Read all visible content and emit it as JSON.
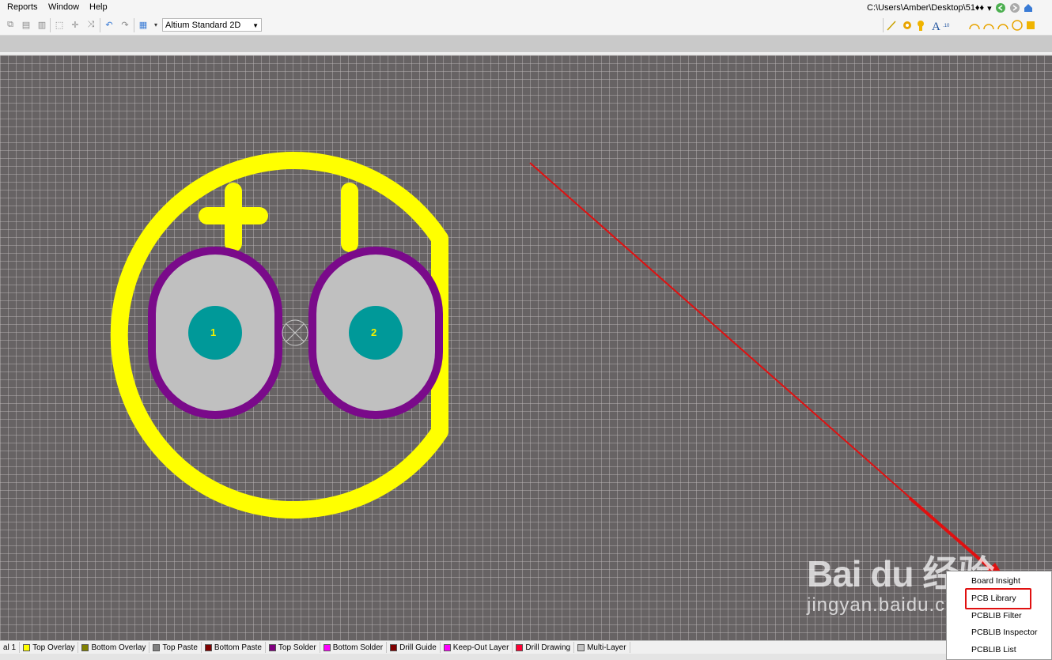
{
  "menu": {
    "reports": "Reports",
    "window": "Window",
    "help": "Help"
  },
  "path": {
    "text": "C:\\Users\\Amber\\Desktop\\51♦♦",
    "dropdown": "▾"
  },
  "toolbar": {
    "view_mode": "Altium Standard 2D",
    "dropdown_arrow": "▼"
  },
  "pcb": {
    "pads": [
      {
        "label": "1"
      },
      {
        "label": "2"
      }
    ],
    "colors": {
      "overlay": "#ffff00",
      "solder": "#7a0a8a",
      "pad": "#c0c0c0",
      "hole": "#009999",
      "background": "#676364"
    }
  },
  "layers": [
    {
      "name": "al 1",
      "color": ""
    },
    {
      "name": "Top Overlay",
      "color": "#ffff00"
    },
    {
      "name": "Bottom Overlay",
      "color": "#808000"
    },
    {
      "name": "Top Paste",
      "color": "#808080"
    },
    {
      "name": "Bottom Paste",
      "color": "#800000"
    },
    {
      "name": "Top Solder",
      "color": "#800080"
    },
    {
      "name": "Bottom Solder",
      "color": "#ff00ff"
    },
    {
      "name": "Drill Guide",
      "color": "#800000"
    },
    {
      "name": "Keep-Out Layer",
      "color": "#ff00ff"
    },
    {
      "name": "Drill Drawing",
      "color": "#ff0033"
    },
    {
      "name": "Multi-Layer",
      "color": "#c0c0c0"
    }
  ],
  "popup_menu": {
    "items": [
      "Board Insight",
      "PCB Library",
      "PCBLIB Filter",
      "PCBLIB Inspector",
      "PCBLIB List"
    ]
  },
  "watermark": {
    "logo": "Bai du 经验",
    "url": "jingyan.baidu.com"
  }
}
